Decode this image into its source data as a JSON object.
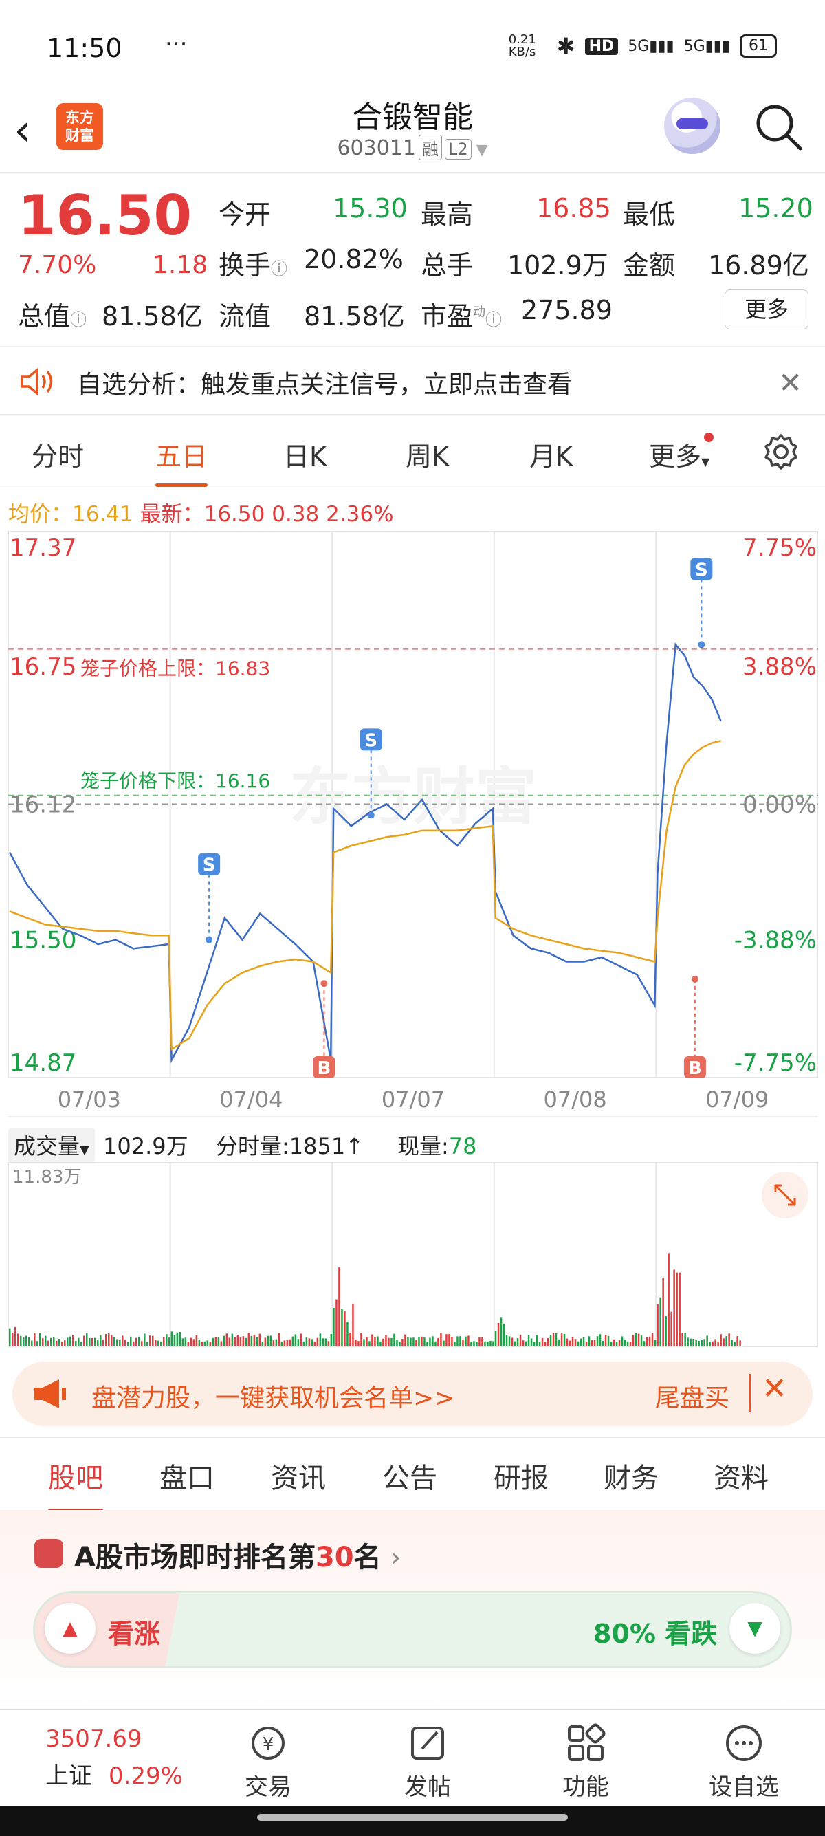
{
  "status_bar": {
    "time": "11:50",
    "dots": "···",
    "net_speed": "0.21 KB/s",
    "hd": "HD",
    "signal1": "5G",
    "signal2": "5G",
    "battery": "61"
  },
  "header": {
    "logo_line1": "东方",
    "logo_line2": "财富",
    "title": "合锻智能",
    "code": "603011",
    "tag1": "融",
    "tag2": "L2"
  },
  "quote": {
    "price": "16.50",
    "change_pct": "7.70%",
    "change": "1.18",
    "open_label": "今开",
    "open": "15.30",
    "high_label": "最高",
    "high": "16.85",
    "low_label": "最低",
    "low": "15.20",
    "turnover_label": "换手",
    "turnover": "20.82%",
    "volume_label": "总手",
    "volume": "102.9万",
    "amount_label": "金额",
    "amount": "16.89亿",
    "mktcap_label": "总值",
    "mktcap": "81.58亿",
    "float_label": "流值",
    "float": "81.58亿",
    "pe_label": "市盈",
    "pe_sup": "动",
    "pe": "275.89",
    "more_label": "更多"
  },
  "banner": {
    "text": "自选分析：触发重点关注信号，立即点击查看"
  },
  "tabs": [
    "分时",
    "五日",
    "日K",
    "周K",
    "月K",
    "更多"
  ],
  "price_line": {
    "avg_label": "均价：",
    "avg": "16.41",
    "latest_label": "最新：",
    "latest": "16.50",
    "chg": "0.38",
    "pct": "2.36%"
  },
  "chart_data": {
    "type": "line",
    "title": "",
    "y_labels_left": [
      "17.37",
      "16.75",
      "16.12",
      "15.50",
      "14.87"
    ],
    "y_labels_right": [
      "7.75%",
      "3.88%",
      "0.00%",
      "-3.88%",
      "-7.75%"
    ],
    "ylim": [
      14.87,
      17.37
    ],
    "x_labels": [
      "07/03",
      "07/04",
      "07/07",
      "07/08",
      "07/09"
    ],
    "upper_cage_label": "笼子价格上限：16.83",
    "upper_cage": 16.83,
    "lower_cage_label": "笼子价格下限：16.16",
    "lower_cage": 16.16,
    "prev_close": 16.12,
    "watermark": "东方财富",
    "series": [
      {
        "name": "price",
        "color": "#3a6bc4",
        "values": [
          15.9,
          15.75,
          15.65,
          15.55,
          15.52,
          15.48,
          15.5,
          15.46,
          15.47,
          15.48,
          14.95,
          15.1,
          15.35,
          15.6,
          15.5,
          15.62,
          15.55,
          15.48,
          15.4,
          14.95,
          16.1,
          16.02,
          16.08,
          16.12,
          16.05,
          16.14,
          16.0,
          15.93,
          16.03,
          16.1,
          15.72,
          15.52,
          15.46,
          15.44,
          15.4,
          15.4,
          15.42,
          15.38,
          15.34,
          15.2,
          15.8,
          16.4,
          16.85,
          16.8,
          16.7,
          16.66,
          16.6,
          16.5
        ]
      },
      {
        "name": "avg",
        "color": "#e8a21a",
        "values": [
          15.63,
          15.6,
          15.57,
          15.56,
          15.55,
          15.54,
          15.54,
          15.53,
          15.52,
          15.52,
          15.0,
          15.05,
          15.2,
          15.3,
          15.35,
          15.38,
          15.4,
          15.41,
          15.4,
          15.35,
          15.9,
          15.93,
          15.95,
          15.97,
          15.98,
          16.0,
          16.0,
          16.0,
          16.01,
          16.02,
          15.6,
          15.55,
          15.52,
          15.5,
          15.48,
          15.46,
          15.45,
          15.44,
          15.42,
          15.4,
          15.6,
          16.0,
          16.2,
          16.3,
          16.35,
          16.38,
          16.4,
          16.41
        ]
      }
    ],
    "signals": [
      {
        "label": "S",
        "day": 1,
        "value": 15.5
      },
      {
        "label": "B",
        "day": 1,
        "value": 15.3
      },
      {
        "label": "S",
        "day": 2,
        "value": 16.07
      },
      {
        "label": "B",
        "day": 4,
        "value": 15.32
      },
      {
        "label": "S",
        "day": 4,
        "value": 16.85
      }
    ]
  },
  "volume": {
    "label": "成交量",
    "total": "102.9万",
    "tick_label": "分时量:",
    "tick": "1851",
    "now_label": "现量:",
    "now": "78",
    "max": "11.83万"
  },
  "ad": {
    "text": "盘潜力股，一键获取机会名单>>",
    "right_text": "尾盘买"
  },
  "bottom_tabs": [
    "股吧",
    "盘口",
    "资讯",
    "公告",
    "研报",
    "财务",
    "资料"
  ],
  "rank": {
    "prefix": "A股市场即时排名第",
    "num": "30",
    "suffix": "名",
    "up_label": "看涨",
    "down_label": "80% 看跌"
  },
  "nav": {
    "index_value": "3507.69",
    "index_name": "上证",
    "index_pct": "0.29%",
    "items": [
      "交易",
      "发帖",
      "功能",
      "设自选"
    ]
  },
  "colors": {
    "up": "#e23b3b",
    "down": "#19a346",
    "accent": "#e8551d",
    "line": "#3a6bc4",
    "avg": "#e8a21a"
  }
}
